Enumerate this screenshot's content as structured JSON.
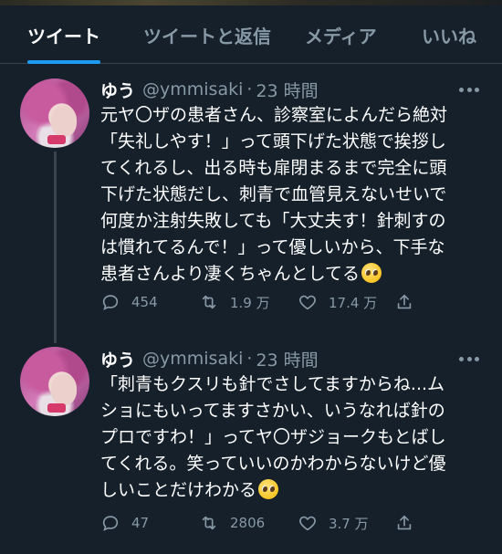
{
  "tabs": [
    {
      "label": "ツイート",
      "active": true
    },
    {
      "label": "ツイートと返信",
      "active": false
    },
    {
      "label": "メディア",
      "active": false
    },
    {
      "label": "いいね",
      "active": false
    }
  ],
  "tweets": [
    {
      "name": "ゆう",
      "handle": "@ymmisaki",
      "separator": "·",
      "time": "23 時間",
      "lines": [
        "元ヤ〇ザの患者さん、診察室によんだら絶対",
        "「失礼しやす！」って頭下げた状態で挨拶し",
        "てくれるし、出る時も扉閉まるまで完全に頭",
        "下げた状態だし、刺青で血管見えないせいで",
        "何度か注射失敗しても「大丈夫す！針刺すの",
        "は慣れてるんで！」って優しいから、下手な",
        "患者さんより凄くちゃんとしてる"
      ],
      "emoji": "pleading-face",
      "replies": "454",
      "retweets": "1.9 万",
      "likes": "17.4 万"
    },
    {
      "name": "ゆう",
      "handle": "@ymmisaki",
      "separator": "·",
      "time": "23 時間",
      "lines": [
        "「刺青もクスリも針でさしてますからね...ム",
        "ショにもいってますさかい、いうなれば針の",
        "プロですわ！」ってヤ〇ザジョークもとばし",
        "てくれる。笑っていいのかわからないけど優",
        "しいことだけわかる"
      ],
      "emoji": "pleading-face",
      "replies": "47",
      "retweets": "2806",
      "likes": "3.7 万"
    }
  ],
  "colors": {
    "background": "#15202b",
    "accent": "#1d9bf0",
    "muted": "#8899a6",
    "divider": "#38444d"
  }
}
